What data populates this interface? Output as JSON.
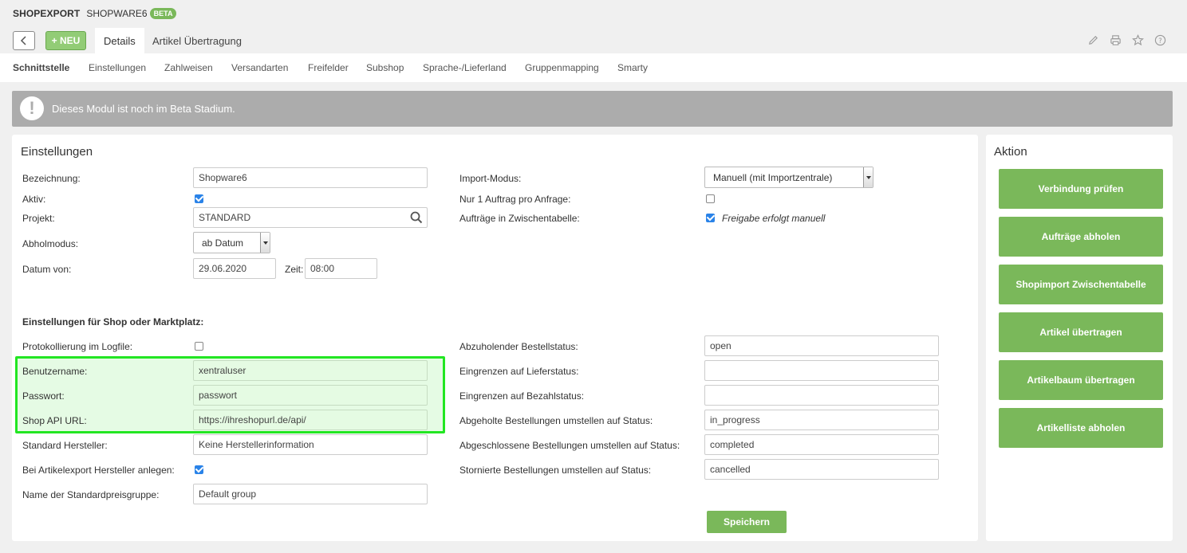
{
  "header": {
    "brand": "SHOPEXPORT",
    "app": "SHOPWARE6",
    "beta_badge": "BETA",
    "new_label": "+ NEU"
  },
  "tabs": [
    {
      "label": "Details"
    },
    {
      "label": "Artikel Übertragung"
    }
  ],
  "toolbar_icons": [
    "edit-icon",
    "print-icon",
    "star-icon",
    "help-icon"
  ],
  "subnav": [
    {
      "label": "Schnittstelle"
    },
    {
      "label": "Einstellungen"
    },
    {
      "label": "Zahlweisen"
    },
    {
      "label": "Versandarten"
    },
    {
      "label": "Freifelder"
    },
    {
      "label": "Subshop"
    },
    {
      "label": "Sprache-/Lieferland"
    },
    {
      "label": "Gruppenmapping"
    },
    {
      "label": "Smarty"
    }
  ],
  "banner": {
    "icon": "!",
    "text": "Dieses Modul ist noch im Beta Stadium."
  },
  "settings": {
    "title": "Einstellungen",
    "bezeichnung": {
      "label": "Bezeichnung:",
      "value": "Shopware6"
    },
    "aktiv": {
      "label": "Aktiv:",
      "checked": true
    },
    "projekt": {
      "label": "Projekt:",
      "value": "STANDARD"
    },
    "abholmodus": {
      "label": "Abholmodus:",
      "value": "ab Datum"
    },
    "datum_von": {
      "label": "Datum von:",
      "value": "29.06.2020"
    },
    "zeit": {
      "label": "Zeit:",
      "value": "08:00"
    },
    "import_modus": {
      "label": "Import-Modus:",
      "value": "Manuell (mit Importzentrale)"
    },
    "nur_ein_auftrag": {
      "label": "Nur 1 Auftrag pro Anfrage:",
      "checked": false
    },
    "zwischentabelle": {
      "label": "Aufträge in Zwischentabelle:",
      "checked": true,
      "note": "Freigabe erfolgt manuell"
    }
  },
  "shop": {
    "heading": "Einstellungen für Shop oder Marktplatz:",
    "protokollierung": {
      "label": "Protokollierung im Logfile:",
      "checked": false
    },
    "benutzername": {
      "label": "Benutzername:",
      "value": "xentraluser"
    },
    "passwort": {
      "label": "Passwort:",
      "value": "passwort"
    },
    "api_url": {
      "label": "Shop API URL:",
      "value": "https://ihreshopurl.de/api/"
    },
    "hersteller": {
      "label": "Standard Hersteller:",
      "value": "Keine Herstellerinformation"
    },
    "hersteller_anlegen": {
      "label": "Bei Artikelexport Hersteller anlegen:",
      "checked": true
    },
    "preisgruppe": {
      "label": "Name der Standardpreisgruppe:",
      "value": "Default group"
    },
    "bestellstatus": {
      "label": "Abzuholender Bestellstatus:",
      "value": "open"
    },
    "lieferstatus": {
      "label": "Eingrenzen auf Lieferstatus:",
      "value": ""
    },
    "bezahlstatus": {
      "label": "Eingrenzen auf Bezahlstatus:",
      "value": ""
    },
    "abgeholte": {
      "label": "Abgeholte Bestellungen umstellen auf Status:",
      "value": "in_progress"
    },
    "abgeschlossene": {
      "label": "Abgeschlossene Bestellungen umstellen auf Status:",
      "value": "completed"
    },
    "stornierte": {
      "label": "Stornierte Bestellungen umstellen auf Status:",
      "value": "cancelled"
    },
    "save_label": "Speichern"
  },
  "aktion": {
    "title": "Aktion",
    "buttons": [
      {
        "label": "Verbindung prüfen"
      },
      {
        "label": "Aufträge abholen"
      },
      {
        "label": "Shopimport Zwischentabelle"
      },
      {
        "label": "Artikel übertragen"
      },
      {
        "label": "Artikelbaum übertragen"
      },
      {
        "label": "Artikelliste abholen"
      }
    ]
  },
  "colors": {
    "accent_green": "#7ab85a",
    "highlight_border": "#22e622",
    "banner_gray": "#acacac",
    "checkbox_blue": "#2a83e8"
  }
}
